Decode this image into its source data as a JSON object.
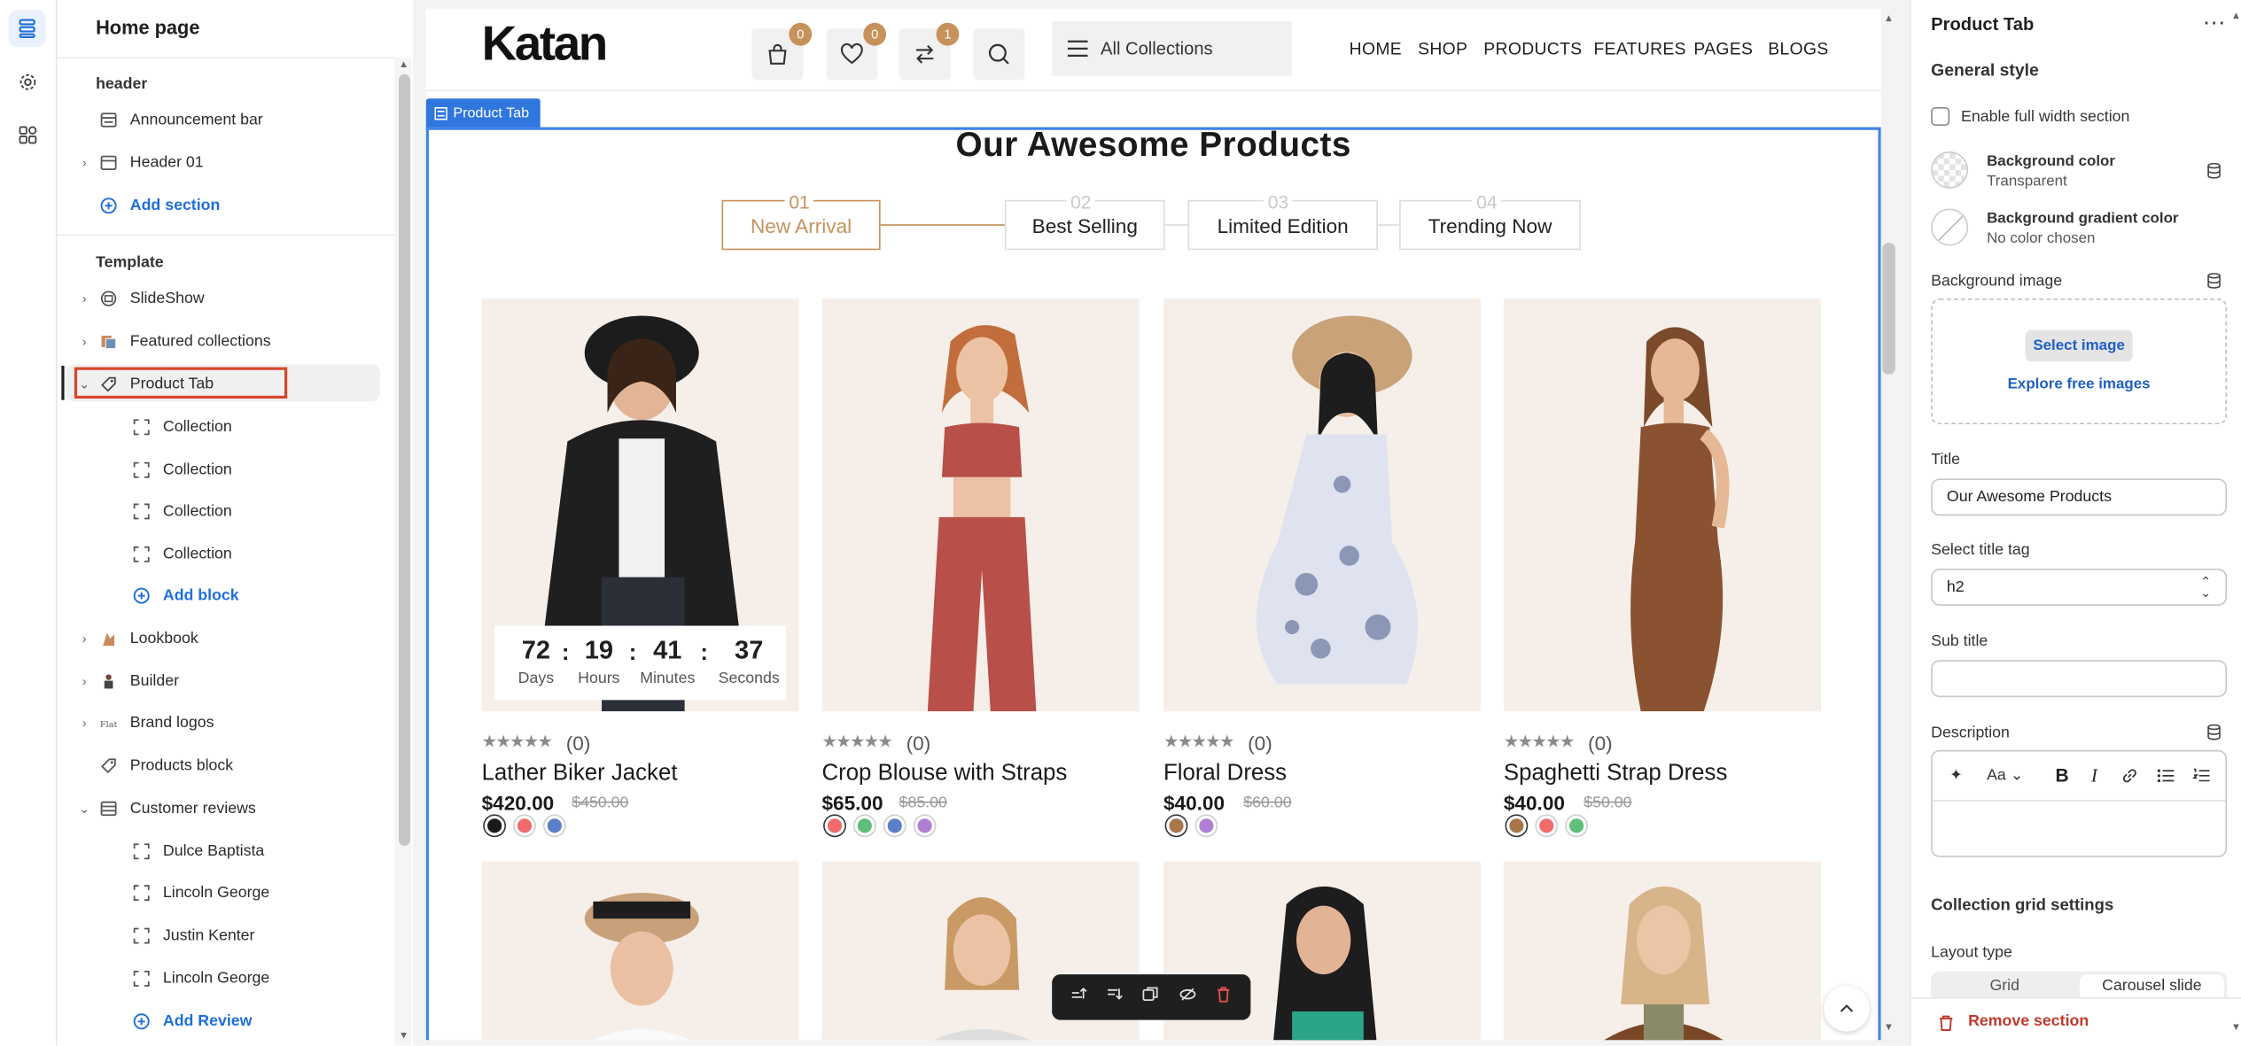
{
  "left_panel": {
    "title": "Home page",
    "header_group": "header",
    "header_items": [
      "Announcement bar",
      "Header 01"
    ],
    "header_add": "Add section",
    "template_group": "Template",
    "template_items": [
      "SlideShow",
      "Featured collections",
      "Product Tab"
    ],
    "product_tab_blocks": [
      "Collection",
      "Collection",
      "Collection",
      "Collection"
    ],
    "product_tab_add": "Add block",
    "more_items": [
      "Lookbook",
      "Builder",
      "Brand logos",
      "Products block",
      "Customer reviews"
    ],
    "review_blocks": [
      "Dulce Baptista",
      "Lincoln George",
      "Justin Kenter",
      "Lincoln George"
    ],
    "review_add": "Add Review"
  },
  "store": {
    "logo": "Katan",
    "cart_count": "0",
    "wishlist_count": "0",
    "compare_count": "1",
    "collections_label": "All Collections",
    "nav": [
      "HOME",
      "SHOP",
      "PRODUCTS",
      "FEATURES",
      "PAGES",
      "BLOGS"
    ],
    "section_tag": "Product Tab",
    "section_title": "Our Awesome Products",
    "tabs": [
      {
        "num": "01",
        "label": "New Arrival"
      },
      {
        "num": "02",
        "label": "Best Selling"
      },
      {
        "num": "03",
        "label": "Limited Edition"
      },
      {
        "num": "04",
        "label": "Trending Now"
      }
    ],
    "countdown": [
      {
        "value": "72",
        "unit": "Days"
      },
      {
        "value": "19",
        "unit": "Hours"
      },
      {
        "value": "41",
        "unit": "Minutes"
      },
      {
        "value": "37",
        "unit": "Seconds"
      }
    ],
    "countdown_sep": ":",
    "stars": "★★★★★",
    "products": [
      {
        "name": "Lather Biker Jacket",
        "price": "$420.00",
        "old_price": "$450.00",
        "reviews": "(0)",
        "swatches": [
          "#1a1a1a",
          "#f06b6b",
          "#5b7fc9"
        ]
      },
      {
        "name": "Crop Blouse with Straps",
        "price": "$65.00",
        "old_price": "$85.00",
        "reviews": "(0)",
        "swatches": [
          "#f06b6b",
          "#5fbf7a",
          "#5b7fc9",
          "#b07ed3"
        ]
      },
      {
        "name": "Floral Dress",
        "price": "$40.00",
        "old_price": "$60.00",
        "reviews": "(0)",
        "swatches": [
          "#a9764a",
          "#b07ed3"
        ]
      },
      {
        "name": "Spaghetti Strap Dress",
        "price": "$40.00",
        "old_price": "$50.00",
        "reviews": "(0)",
        "swatches": [
          "#a9764a",
          "#f06b6b",
          "#5fbf7a"
        ]
      }
    ]
  },
  "right_panel": {
    "title": "Product Tab",
    "general_style": "General style",
    "full_width_label": "Enable full width section",
    "bg_color_label": "Background color",
    "bg_color_value": "Transparent",
    "bg_gradient_label": "Background gradient color",
    "bg_gradient_value": "No color chosen",
    "bg_image_label": "Background image",
    "select_image": "Select image",
    "explore_images": "Explore free images",
    "title_label": "Title",
    "title_value": "Our Awesome Products",
    "title_tag_label": "Select title tag",
    "title_tag_value": "h2",
    "subtitle_label": "Sub title",
    "subtitle_value": "",
    "description_label": "Description",
    "grid_settings": "Collection grid settings",
    "layout_type_label": "Layout type",
    "layout_options": [
      "Grid",
      "Carousel slide"
    ],
    "remove_section": "Remove section"
  },
  "colors": {
    "accent": "#c6915a",
    "editor_blue": "#1e6fd9",
    "danger": "#c0392b",
    "selection": "#d9462c"
  }
}
